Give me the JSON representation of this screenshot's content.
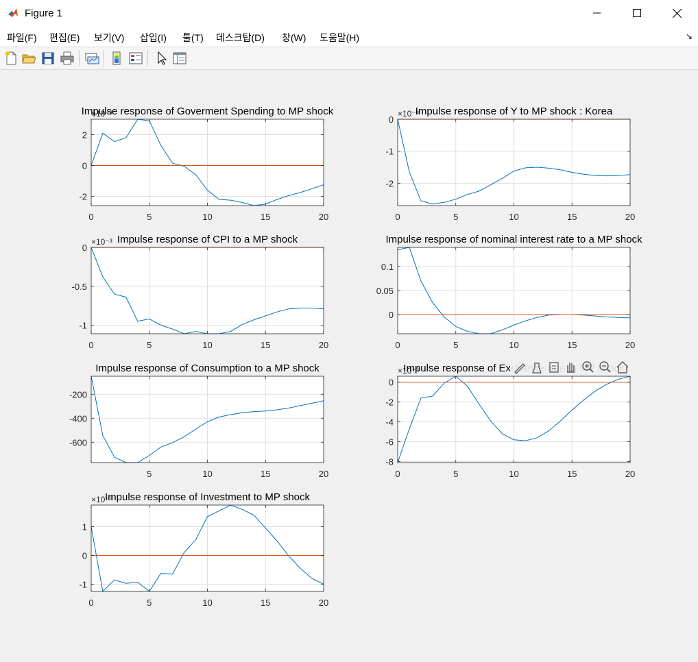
{
  "window": {
    "title": "Figure 1"
  },
  "menu": [
    "파일(F)",
    "편집(E)",
    "보기(V)",
    "삽입(I)",
    "툴(T)",
    "데스크탑(D)",
    "창(W)",
    "도움말(H)"
  ],
  "colors": {
    "response": "#0072bd",
    "zero_line": "#d95319",
    "figure_bg": "#f0f0f0"
  },
  "toolbar_icons": [
    "new-figure-icon",
    "open-file-icon",
    "save-icon",
    "print-icon",
    "link-plot-icon",
    "colorbar-icon",
    "legend-icon",
    "edit-plot-icon",
    "property-inspector-icon"
  ],
  "axes_toolbar_icons": [
    "brush-icon",
    "data-tips-icon",
    "restore-view-icon",
    "pan-icon",
    "zoom-in-icon",
    "zoom-out-icon",
    "home-icon"
  ],
  "chart_data": [
    {
      "type": "line",
      "title": "Impulse response of Goverment Spending to MP shock",
      "exponent": "×10⁻³",
      "x": [
        0,
        1,
        2,
        3,
        4,
        5,
        6,
        7,
        8,
        9,
        10,
        11,
        12,
        13,
        14,
        15,
        16,
        17,
        18,
        19,
        20
      ],
      "series": [
        {
          "values": [
            0.0,
            2.1,
            1.55,
            1.8,
            3.1,
            2.9,
            1.3,
            0.15,
            -0.05,
            -0.6,
            -1.6,
            -2.2,
            -2.25,
            -2.4,
            -2.6,
            -2.5,
            -2.2,
            -1.95,
            -1.75,
            -1.5,
            -1.25
          ]
        },
        {
          "values": [
            0,
            0,
            0,
            0,
            0,
            0,
            0,
            0,
            0,
            0,
            0,
            0,
            0,
            0,
            0,
            0,
            0,
            0,
            0,
            0,
            0
          ]
        }
      ],
      "xlim": [
        0,
        20
      ],
      "ylim": [
        -2.6,
        3.0
      ],
      "xticks": [
        "0",
        "5",
        "10",
        "15",
        "20"
      ],
      "yticks": [
        {
          "value": 2,
          "label": "2"
        },
        {
          "value": 0,
          "label": "0"
        },
        {
          "value": -2,
          "label": "-2"
        }
      ],
      "grid": true
    },
    {
      "type": "line",
      "title": "Impulse response of Y to MP shock : Korea",
      "exponent": "×10⁻³",
      "x": [
        0,
        1,
        2,
        3,
        4,
        5,
        6,
        7,
        8,
        9,
        10,
        11,
        12,
        13,
        14,
        15,
        16,
        17,
        18,
        19,
        20
      ],
      "series": [
        {
          "values": [
            0.0,
            -1.65,
            -2.55,
            -2.65,
            -2.6,
            -2.5,
            -2.35,
            -2.25,
            -2.05,
            -1.85,
            -1.62,
            -1.52,
            -1.5,
            -1.53,
            -1.58,
            -1.66,
            -1.72,
            -1.76,
            -1.77,
            -1.76,
            -1.73
          ]
        },
        {
          "values": [
            0,
            0,
            0,
            0,
            0,
            0,
            0,
            0,
            0,
            0,
            0,
            0,
            0,
            0,
            0,
            0,
            0,
            0,
            0,
            0,
            0
          ]
        }
      ],
      "xlim": [
        0,
        20
      ],
      "ylim": [
        -2.7,
        0
      ],
      "xticks": [
        "0",
        "5",
        "10",
        "15",
        "20"
      ],
      "yticks": [
        {
          "value": 0,
          "label": "0"
        },
        {
          "value": -1,
          "label": "-1"
        },
        {
          "value": -2,
          "label": "-2"
        }
      ],
      "grid": true
    },
    {
      "type": "line",
      "title": "Impulse response of CPI to a MP shock",
      "exponent": "×10⁻³",
      "x": [
        0,
        1,
        2,
        3,
        4,
        5,
        6,
        7,
        8,
        9,
        10,
        11,
        12,
        13,
        14,
        15,
        16,
        17,
        18,
        19,
        20
      ],
      "series": [
        {
          "values": [
            0.0,
            -0.38,
            -0.6,
            -0.64,
            -0.95,
            -0.92,
            -1.0,
            -1.05,
            -1.12,
            -1.08,
            -1.12,
            -1.12,
            -1.08,
            -0.99,
            -0.93,
            -0.88,
            -0.83,
            -0.79,
            -0.78,
            -0.78,
            -0.79
          ]
        },
        {
          "values": [
            0,
            0,
            0,
            0,
            0,
            0,
            0,
            0,
            0,
            0,
            0,
            0,
            0,
            0,
            0,
            0,
            0,
            0,
            0,
            0,
            0
          ]
        }
      ],
      "xlim": [
        0,
        20
      ],
      "ylim": [
        -1.11,
        0
      ],
      "xticks": [
        "0",
        "5",
        "10",
        "15",
        "20"
      ],
      "yticks": [
        {
          "value": 0,
          "label": "0"
        },
        {
          "value": -0.5,
          "label": "-0.5"
        },
        {
          "value": -1,
          "label": "-1"
        }
      ],
      "grid": true
    },
    {
      "type": "line",
      "title": "Impulse response of nominal interest rate to a MP shock",
      "exponent": "",
      "x": [
        0,
        1,
        2,
        3,
        4,
        5,
        6,
        7,
        8,
        9,
        10,
        11,
        12,
        13,
        14,
        15,
        16,
        17,
        18,
        19,
        20
      ],
      "series": [
        {
          "values": [
            0.135,
            0.145,
            0.07,
            0.025,
            -0.005,
            -0.025,
            -0.035,
            -0.04,
            -0.04,
            -0.032,
            -0.022,
            -0.013,
            -0.006,
            -0.001,
            0.0,
            0.0,
            -0.001,
            -0.003,
            -0.005,
            -0.006,
            -0.007
          ]
        },
        {
          "values": [
            0,
            0,
            0,
            0,
            0,
            0,
            0,
            0,
            0,
            0,
            0,
            0,
            0,
            0,
            0,
            0,
            0,
            0,
            0,
            0,
            0
          ]
        }
      ],
      "xlim": [
        0,
        20
      ],
      "ylim": [
        -0.04,
        0.14
      ],
      "xticks": [
        "0",
        "5",
        "10",
        "15",
        "20"
      ],
      "yticks": [
        {
          "value": 0.1,
          "label": "0.1"
        },
        {
          "value": 0.05,
          "label": "0.05"
        },
        {
          "value": 0,
          "label": "0"
        }
      ],
      "grid": true
    },
    {
      "type": "line",
      "title": "Impulse response of Consumption to a MP shock",
      "exponent": "",
      "x": [
        0,
        1,
        2,
        3,
        4,
        5,
        6,
        7,
        8,
        9,
        10,
        11,
        12,
        13,
        14,
        15,
        16,
        17,
        18,
        19,
        20
      ],
      "series": [
        {
          "values": [
            -50,
            -545,
            -725,
            -770,
            -775,
            -710,
            -640,
            -605,
            -555,
            -490,
            -430,
            -390,
            -370,
            -355,
            -345,
            -340,
            -330,
            -315,
            -295,
            -275,
            -255
          ]
        }
      ],
      "xlim": [
        0,
        20
      ],
      "ylim": [
        -770,
        -50
      ],
      "xticks": [
        "",
        "5",
        "10",
        "15",
        "20"
      ],
      "yticks": [
        {
          "value": -200,
          "label": "-200"
        },
        {
          "value": -400,
          "label": "-400"
        },
        {
          "value": -600,
          "label": "-600"
        }
      ],
      "grid": true
    },
    {
      "type": "line",
      "title": "Impulse response of Exchange rate to MP shock",
      "exponent": "×10⁻³",
      "x": [
        0,
        1,
        2,
        3,
        4,
        5,
        6,
        7,
        8,
        9,
        10,
        11,
        12,
        13,
        14,
        15,
        16,
        17,
        18,
        19,
        20
      ],
      "series": [
        {
          "values": [
            -8.1,
            -4.7,
            -1.6,
            -1.4,
            -0.1,
            0.6,
            -0.4,
            -2.2,
            -3.9,
            -5.2,
            -5.8,
            -5.9,
            -5.6,
            -4.9,
            -3.9,
            -2.8,
            -1.8,
            -0.9,
            -0.2,
            0.3,
            0.6
          ]
        },
        {
          "values": [
            0,
            0,
            0,
            0,
            0,
            0,
            0,
            0,
            0,
            0,
            0,
            0,
            0,
            0,
            0,
            0,
            0,
            0,
            0,
            0,
            0
          ]
        }
      ],
      "xlim": [
        0,
        20
      ],
      "ylim": [
        -8.1,
        0.6
      ],
      "xticks": [
        "0",
        "5",
        "10",
        "15",
        "20"
      ],
      "yticks": [
        {
          "value": 0,
          "label": "0"
        },
        {
          "value": -2,
          "label": "-2"
        },
        {
          "value": -4,
          "label": "-4"
        },
        {
          "value": -6,
          "label": "-6"
        },
        {
          "value": -8,
          "label": "-8"
        }
      ],
      "grid": true
    },
    {
      "type": "line",
      "title": "Impulse response of Investment to MP shock",
      "exponent": "×10⁻³",
      "x": [
        0,
        1,
        2,
        3,
        4,
        5,
        6,
        7,
        8,
        9,
        10,
        11,
        12,
        13,
        14,
        15,
        16,
        17,
        18,
        19,
        20
      ],
      "series": [
        {
          "values": [
            1.0,
            -1.25,
            -0.85,
            -0.97,
            -0.93,
            -1.3,
            -0.62,
            -0.65,
            0.1,
            0.55,
            1.35,
            1.55,
            1.75,
            1.6,
            1.4,
            0.95,
            0.5,
            -0.02,
            -0.45,
            -0.8,
            -1.0
          ]
        },
        {
          "values": [
            0,
            0,
            0,
            0,
            0,
            0,
            0,
            0,
            0,
            0,
            0,
            0,
            0,
            0,
            0,
            0,
            0,
            0,
            0,
            0,
            0
          ]
        }
      ],
      "xlim": [
        0,
        20
      ],
      "ylim": [
        -1.25,
        1.75
      ],
      "xticks": [
        "0",
        "5",
        "10",
        "15",
        "20"
      ],
      "yticks": [
        {
          "value": 1,
          "label": "1"
        },
        {
          "value": 0,
          "label": "0"
        },
        {
          "value": -1,
          "label": "-1"
        }
      ],
      "grid": true
    }
  ]
}
